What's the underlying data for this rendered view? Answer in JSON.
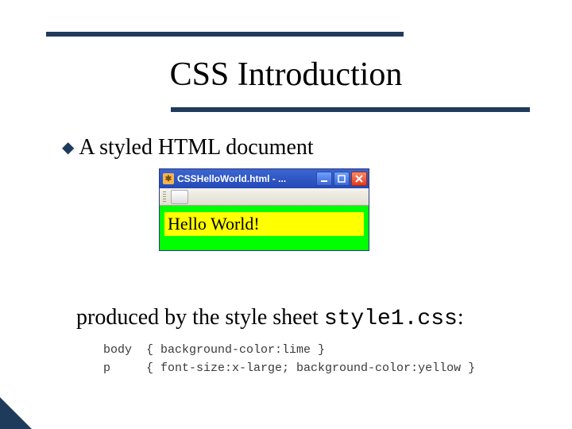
{
  "slide": {
    "title": "CSS Introduction",
    "bullet": "A styled HTML document",
    "produced_prefix": "produced by the style sheet ",
    "produced_code": "style1.css",
    "produced_suffix": ":"
  },
  "window": {
    "title": "CSSHelloWorld.html - ...",
    "content_text": "Hello World!"
  },
  "code": {
    "line1": "body  { background-color:lime }",
    "line2": "p     { font-size:x-large; background-color:yellow }"
  },
  "icons": {
    "bullet": "◆"
  }
}
